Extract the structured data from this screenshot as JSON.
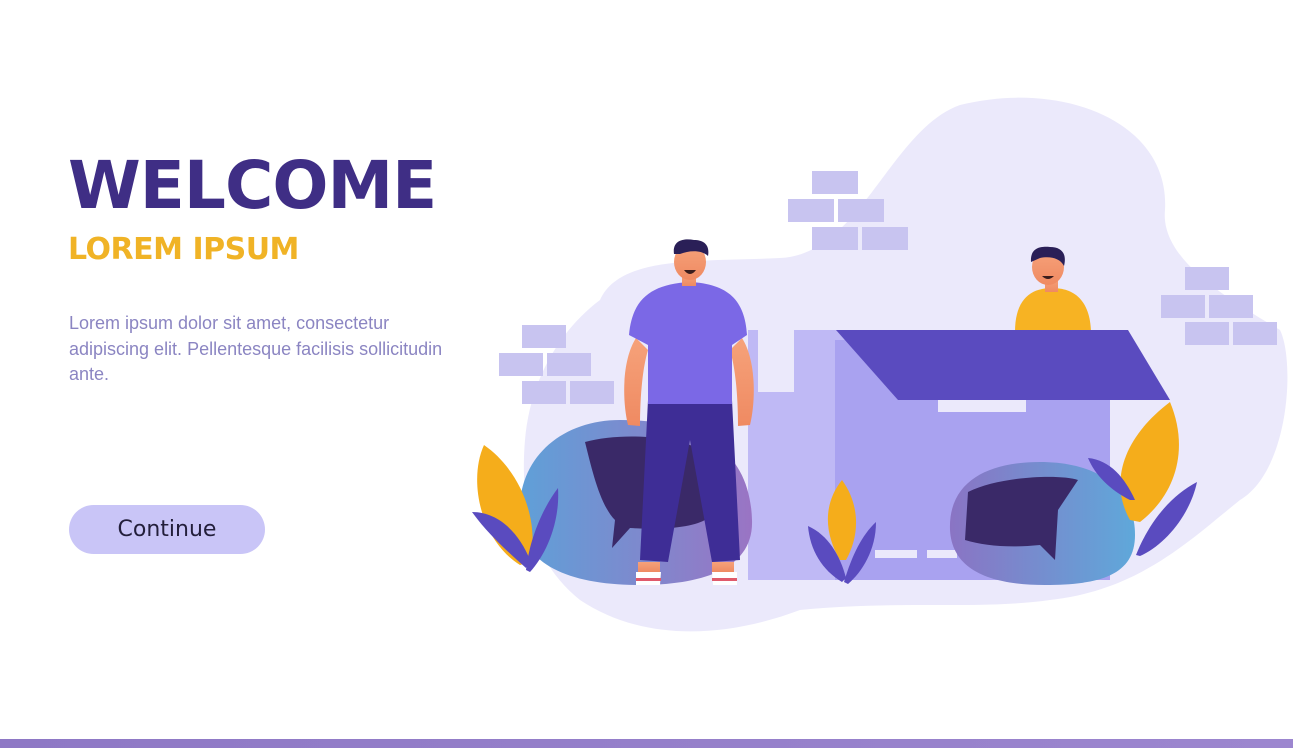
{
  "hero": {
    "title": "WELCOME",
    "subtitle": "LOREM IPSUM",
    "body": "Lorem ipsum dolor sit amet, consectetur adipiscing elit. Pellentesque facilisis sollicitudin ante.",
    "button_label": "Continue"
  },
  "colors": {
    "title": "#3f2e85",
    "subtitle": "#f0b326",
    "body_text": "#8b85c2",
    "button_bg": "#c9c5f7",
    "blob": "#ebe9fb",
    "bricks": "#c8c4f0",
    "roof": "#5a4bbf",
    "box": "#a9a2f0",
    "shirt_man": "#7b68e6",
    "pants_man": "#3e2d96",
    "shirt_woman": "#f7b323",
    "leaf_orange": "#f5ad1b",
    "leaf_purple": "#5a4bbf",
    "beanbag": "#5f9bd6",
    "bottom_bar": "#8e78c5"
  },
  "illustration": {
    "elements": [
      "background-blob",
      "brick-cluster",
      "box-house",
      "standing-man",
      "peeking-person",
      "beanbag-chair",
      "plants"
    ]
  }
}
